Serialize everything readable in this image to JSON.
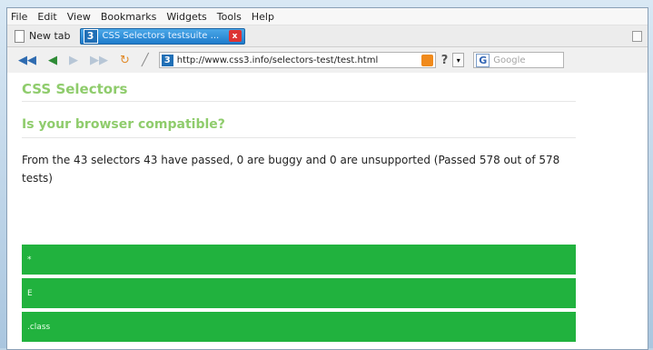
{
  "menu": [
    "File",
    "Edit",
    "View",
    "Bookmarks",
    "Widgets",
    "Tools",
    "Help"
  ],
  "tabs": {
    "new_tab_label": "New tab",
    "active_badge": "3",
    "active_title": "CSS Selectors testsuite ...",
    "close": "x"
  },
  "nav": {
    "site_badge": "3",
    "url": "http://www.css3.info/selectors-test/test.html",
    "rss_label": "rss",
    "help": "?",
    "dropdown": "▾",
    "search_icon": "G",
    "search_placeholder": "Google"
  },
  "page": {
    "title": "CSS Selectors",
    "subtitle": "Is your browser compatible?",
    "summary": "From the 43 selectors 43 have passed, 0 are buggy and 0 are unsupported (Passed 578 out of 578 tests)",
    "results": [
      {
        "selector": "*"
      },
      {
        "selector": "E"
      },
      {
        "selector": ".class"
      }
    ]
  },
  "colors": {
    "pass": "#21b23e",
    "heading": "#8fcc6c"
  }
}
